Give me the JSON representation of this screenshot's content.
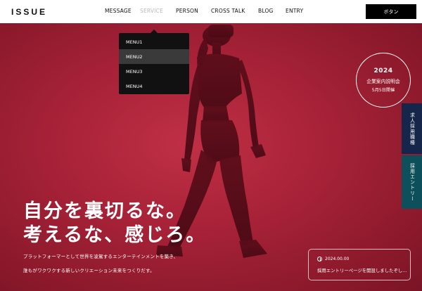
{
  "header": {
    "logo": "ISSUE",
    "nav": [
      "MESSAGE",
      "SERVICE",
      "PERSON",
      "CROSS TALK",
      "BLOG",
      "ENTRY"
    ],
    "cta_label": "ボタン"
  },
  "dropdown": {
    "items": [
      "MENU1",
      "MENU2",
      "MENU3",
      "MENU4"
    ],
    "active_index": 1
  },
  "event_badge": {
    "year": "2024",
    "title": "企業案内説明会",
    "date": "5月5日開催"
  },
  "side_tabs": [
    "求人採用職種",
    "採用エントリー"
  ],
  "hero": {
    "headline_line1": "自分を裏切るな。",
    "headline_line2": "考えるな、感じろ。",
    "sub_line1": "プラットフォーマーとして世界を凌駕するエンターテインメントを築き、",
    "sub_line2": "誰もがワクワクする新しいクリエーション未来をつくりだす。"
  },
  "news": {
    "date": "2024.00.00",
    "text": "採用エントリーページを開設しましたぞし…"
  },
  "colors": {
    "hero_red": "#a82238",
    "tab_navy": "#16264b",
    "tab_teal": "#0d4f5a",
    "header_bg": "#ffffff",
    "cta_bg": "#000000"
  },
  "icons": [
    "clock-icon"
  ]
}
